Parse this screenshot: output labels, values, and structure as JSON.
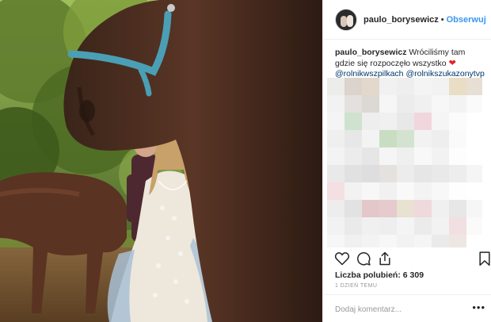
{
  "post": {
    "username": "paulo_borysewicz",
    "separator": "•",
    "follow_label": "Obserwuj"
  },
  "caption": {
    "username": "paulo_borysewicz",
    "text": "Wróciliśmy tam gdzie się rozpoczęło wszystko",
    "tags": [
      "@rolnikwszpilkach",
      "@rolnikszukazonytvp"
    ]
  },
  "icons": {
    "like": "heart-outline-icon",
    "comment": "speech-bubble-icon",
    "share": "share-icon",
    "save": "bookmark-icon",
    "more": "ellipsis-icon",
    "caption_emoji": "red-heart-icon"
  },
  "likes": {
    "label": "Liczba polubień:",
    "count": "6 309"
  },
  "timestamp": "1 DZIEŃ TEMU",
  "comment_input": {
    "placeholder": "Dodaj komentarz..."
  },
  "more_label": "•••",
  "colors": {
    "link": "#3897f0",
    "hashtag": "#003569",
    "heart": "#e2242c",
    "border": "#efefef",
    "muted": "#999999"
  }
}
